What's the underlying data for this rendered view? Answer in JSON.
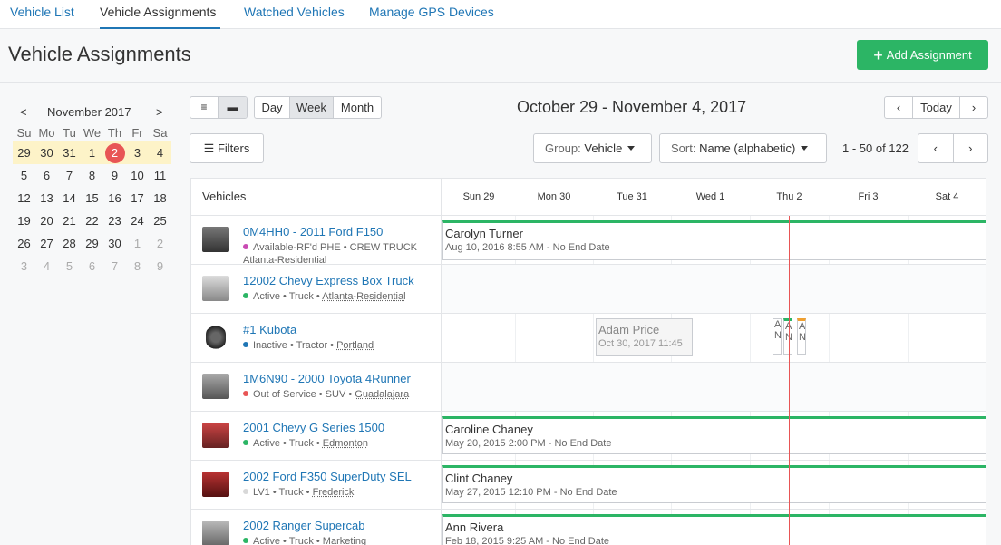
{
  "nav": {
    "tabs": [
      "Vehicle List",
      "Vehicle Assignments",
      "Watched Vehicles",
      "Manage GPS Devices"
    ]
  },
  "header": {
    "title": "Vehicle Assignments",
    "add_label": "Add Assignment"
  },
  "calendar": {
    "month": "November 2017",
    "prev": "<",
    "next": ">",
    "weekdays": [
      "Su",
      "Mo",
      "Tu",
      "We",
      "Th",
      "Fr",
      "Sa"
    ],
    "weeks": [
      [
        "29",
        "30",
        "31",
        "1",
        "2",
        "3",
        "4"
      ],
      [
        "5",
        "6",
        "7",
        "8",
        "9",
        "10",
        "11"
      ],
      [
        "12",
        "13",
        "14",
        "15",
        "16",
        "17",
        "18"
      ],
      [
        "19",
        "20",
        "21",
        "22",
        "23",
        "24",
        "25"
      ],
      [
        "26",
        "27",
        "28",
        "29",
        "30",
        "1",
        "2"
      ],
      [
        "3",
        "4",
        "5",
        "6",
        "7",
        "8",
        "9"
      ]
    ]
  },
  "toolbar": {
    "views": [
      "Day",
      "Week",
      "Month"
    ],
    "active_view": "Week",
    "range": "October 29 - November 4, 2017",
    "today": "Today",
    "filters": "Filters",
    "group_label": "Group:",
    "group_value": "Vehicle",
    "sort_label": "Sort:",
    "sort_value": "Name (alphabetic)",
    "pagination": "1 - 50 of 122"
  },
  "grid": {
    "vehicles_header": "Vehicles",
    "days": [
      "Sun 29",
      "Mon 30",
      "Tue 31",
      "Wed 1",
      "Thu 2",
      "Fri 3",
      "Sat 4"
    ],
    "rows": [
      {
        "name": "0M4HH0 - 2011 Ford F150",
        "status": "Available-RF'd PHE",
        "status_color": "#c94bb3",
        "type": "CREW TRUCK",
        "group": "Atlanta-Residential",
        "assignment": {
          "who": "Carolyn Turner",
          "when": "Aug 10, 2016 8:55 AM - No End Date"
        }
      },
      {
        "name": "12002 Chevy Express Box Truck",
        "status": "Active",
        "status_color": "#2cb565",
        "type": "Truck",
        "group": "Atlanta-Residential"
      },
      {
        "name": "#1 Kubota",
        "status": "Inactive",
        "status_color": "#1f76b5",
        "type": "Tractor",
        "group": "Portland",
        "assignment": {
          "who": "Adam Price",
          "when": "Oct 30, 2017 11:45"
        }
      },
      {
        "name": "1M6N90 - 2000 Toyota 4Runner",
        "status": "Out of Service",
        "status_color": "#e85555",
        "type": "SUV",
        "group": "Guadalajara"
      },
      {
        "name": "2001 Chevy G Series 1500",
        "status": "Active",
        "status_color": "#2cb565",
        "type": "Truck",
        "group": "Edmonton",
        "assignment": {
          "who": "Caroline Chaney",
          "when": "May 20, 2015 2:00 PM - No End Date"
        }
      },
      {
        "name": "2002 Ford F350 SuperDuty SEL",
        "status": "LV1",
        "status_color": "#d8d8d8",
        "type": "Truck",
        "group": "Frederick",
        "assignment": {
          "who": "Clint Chaney",
          "when": "May 27, 2015 12:10 PM - No End Date"
        }
      },
      {
        "name": "2002 Ranger Supercab",
        "status": "Active",
        "status_color": "#2cb565",
        "type": "Truck",
        "group": "Marketing",
        "assignment": {
          "who": "Ann Rivera",
          "when": "Feb 18, 2015 9:25 AM - No End Date"
        }
      }
    ],
    "mini_letters": [
      "A",
      "A",
      "A"
    ],
    "mini_sub": [
      "N",
      "N",
      "N"
    ]
  },
  "colors": {
    "accent": "#1f76b5",
    "primary_button": "#2cb565",
    "today": "#e85555",
    "current_week": "#fdf3c8"
  }
}
